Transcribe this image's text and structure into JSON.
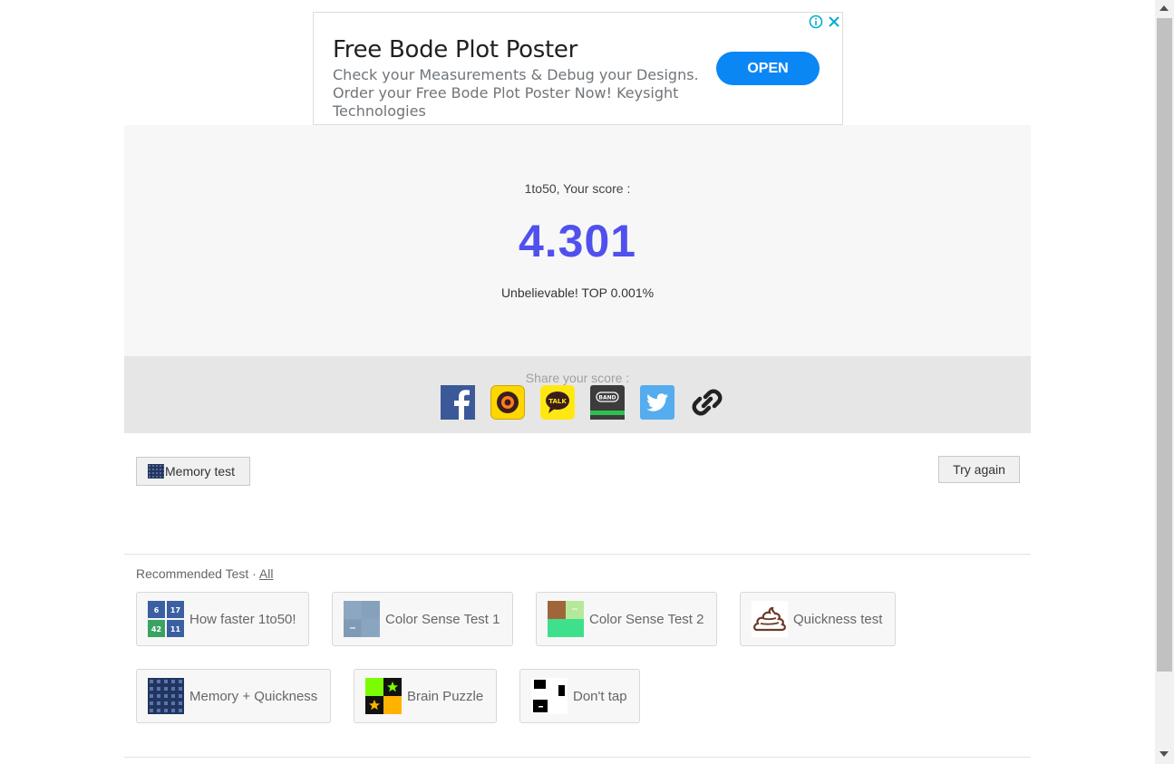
{
  "ad": {
    "title": "Free Bode Plot Poster",
    "description": "Check your Measurements & Debug your Designs. Order your Free Bode Plot Poster Now! Keysight Technologies",
    "cta_label": "OPEN",
    "info_icon": "info-icon",
    "close_icon": "close-icon",
    "accent": "#0b87f5"
  },
  "result": {
    "label": "1to50, Your score :",
    "score": "4.301",
    "rank": "Unbelievable! TOP 0.001%",
    "score_color": "#5050ee"
  },
  "share": {
    "label": "Share your score :",
    "icons": [
      "facebook-icon",
      "kakaostory-icon",
      "kakaotalk-icon",
      "band-icon",
      "twitter-icon",
      "link-icon"
    ]
  },
  "buttons": {
    "memory_test": "Memory test",
    "try_again": "Try again"
  },
  "recommended": {
    "title": "Recommended Test · ",
    "all_link": "All",
    "row1": [
      {
        "label": "How faster 1to50!",
        "thumb": [
          "6",
          "17",
          "42",
          "11"
        ]
      },
      {
        "label": "Color Sense Test 1"
      },
      {
        "label": "Color Sense Test 2"
      },
      {
        "label": "Quickness test"
      }
    ],
    "row2": [
      {
        "label": "Memory + Quickness"
      },
      {
        "label": "Brain Puzzle"
      },
      {
        "label": "Don't tap"
      }
    ]
  }
}
